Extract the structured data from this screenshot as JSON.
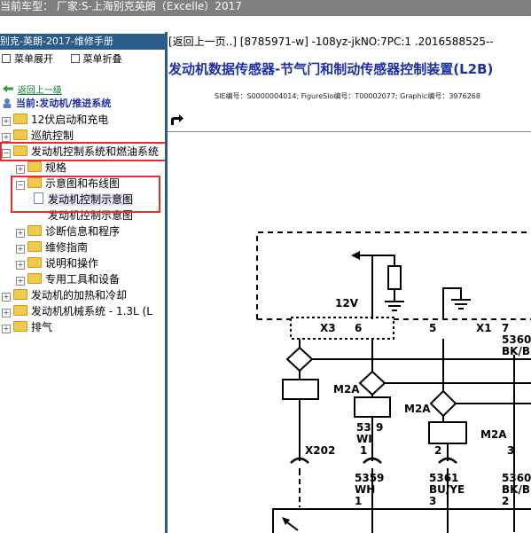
{
  "topbar": {
    "text": "当前车型： 厂家:S-上海别克英朗（Excelle）2017"
  },
  "left_panel": {
    "title": "别克-英朗-2017-维修手册",
    "expand_label": "菜单展开",
    "collapse_label": "菜单折叠",
    "back_link": "返回上一级",
    "current": "当前:发动机/推进系统",
    "tree": [
      {
        "label": "12伏启动和充电",
        "level": 0,
        "expanded": false
      },
      {
        "label": "巡航控制",
        "level": 0,
        "expanded": false
      },
      {
        "label": "发动机控制系统和燃油系统",
        "level": 0,
        "expanded": true
      },
      {
        "label": "规格",
        "level": 1,
        "expanded": false
      },
      {
        "label": "示意图和布线图",
        "level": 1,
        "expanded": true
      },
      {
        "label": "发动机控制示意图",
        "level": 2,
        "selected": true
      },
      {
        "label": "发动机控制示意图",
        "level": 2,
        "selected": false
      },
      {
        "label": "诊断信息和程序",
        "level": 1,
        "expanded": false
      },
      {
        "label": "维修指南",
        "level": 1,
        "expanded": false
      },
      {
        "label": "说明和操作",
        "level": 1,
        "expanded": false
      },
      {
        "label": "专用工具和设备",
        "level": 1,
        "expanded": false
      },
      {
        "label": "发动机的加热和冷却",
        "level": 0,
        "expanded": false
      },
      {
        "label": "发动机机械系统 - 1.3L (L",
        "level": 0,
        "expanded": false
      },
      {
        "label": "排气",
        "level": 0,
        "expanded": false
      }
    ]
  },
  "right_panel": {
    "breadcrumb": "[返回上一页..] [8785971-w] -108yz-jkNO:7PC:1 .2016588525--",
    "title": "发动机数据传感器-节气门和制动传感器控制装置(L2B)",
    "meta": "SIE编号：S0000004014;  FigureSio编号：T00002077;  Graphic编号：3976268",
    "diagram": {
      "voltage": "12V",
      "connector_x3": "X3",
      "pin_6": "6",
      "pin_5": "5",
      "connector_x1": "X1",
      "pin_7": "7",
      "wire_5360_bk_1": "5360",
      "wire_5360_bk_1b": "BK/B",
      "m2a_1": "M2A",
      "m2a_2": "M2A",
      "m2a_3": "M2A",
      "pin_9": "9",
      "wire_53": "53",
      "wire_wi": "WI",
      "pin_1": "1",
      "pin_2": "2",
      "pin_3": "3",
      "x202": "X202",
      "w5359": "5359",
      "w5359c": "WH",
      "w5359p": "1",
      "w5361": "5361",
      "w5361c": "BU/YE",
      "w5361p": "3",
      "w5360b": "5360",
      "w5360bc": "BK/B",
      "w5360bp": "2"
    }
  },
  "colors": {
    "topbar": "#7f7f7f",
    "panel_header": "#2b5c8a",
    "title_blue": "#1c2fa8",
    "highlight_red": "#e03030",
    "link_green": "#0a7a2a"
  }
}
